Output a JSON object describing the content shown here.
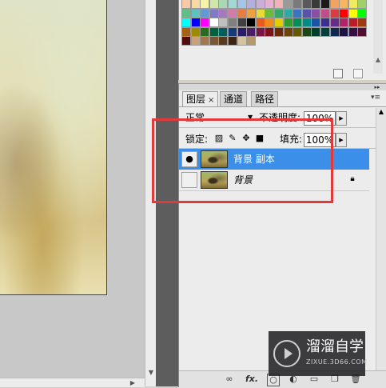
{
  "layers_panel": {
    "tabs": [
      {
        "label": "图层",
        "active": true
      },
      {
        "label": "通道",
        "active": false
      },
      {
        "label": "路径",
        "active": false
      }
    ],
    "tab_close_glyph": "×",
    "blend_mode": "正常",
    "opacity_label": "不透明度:",
    "opacity_value": "100%",
    "lock_label": "锁定:",
    "fill_label": "填充:",
    "fill_value": "100%",
    "layers": [
      {
        "name": "背景 副本",
        "visible": true,
        "selected": true,
        "locked": false
      },
      {
        "name": "背景",
        "visible": false,
        "selected": false,
        "locked": true
      }
    ],
    "bottom_icons": [
      "link-icon",
      "fx-icon",
      "mask-icon",
      "adjustment-icon",
      "group-icon",
      "new-layer-icon",
      "trash-icon"
    ],
    "fx_label": "fx."
  },
  "swatches": {
    "colors": [
      "#f7c9a6",
      "#f8d9a3",
      "#f6f2a6",
      "#cfe7a8",
      "#a9d8b2",
      "#a3d9d5",
      "#a5c4e6",
      "#b3b0dc",
      "#c9afd8",
      "#e6b1cf",
      "#f1b4b6",
      "#9a9a9a",
      "#7a7a7a",
      "#5a5a5a",
      "#3a3a3a",
      "#1a1a1a",
      "#f2a35f",
      "#f6b55f",
      "#f0ea5e",
      "#9fd06a",
      "#5fbf86",
      "#5fc2bf",
      "#6099d6",
      "#7f7ac5",
      "#a678bd",
      "#d47aa9",
      "#e87d3e",
      "#efa23b",
      "#e6dc35",
      "#6dbb3c",
      "#32a86a",
      "#2fa9a4",
      "#3a73c0",
      "#5952ad",
      "#8a4fa4",
      "#c24c8b",
      "#d83c42",
      "#ff0000",
      "#ffff00",
      "#00ff00",
      "#00ffff",
      "#0000ff",
      "#ff00ff",
      "#ffffff",
      "#c0c0c0",
      "#808080",
      "#404040",
      "#000000",
      "#e85a1e",
      "#f08a1a",
      "#e2cf00",
      "#2f9e2f",
      "#008f58",
      "#008c88",
      "#1a53a8",
      "#3a2f92",
      "#6a2a8a",
      "#b0246a",
      "#b81c24",
      "#9e3a12",
      "#a66212",
      "#9c8a00",
      "#2c6a1e",
      "#006040",
      "#005e5c",
      "#163a78",
      "#2a1c66",
      "#4c1c64",
      "#7a1646",
      "#7a1418",
      "#6b2a0c",
      "#6e420c",
      "#645800",
      "#1c4614",
      "#00402a",
      "#003e3c",
      "#0e2852",
      "#1c1246",
      "#340e44",
      "#520e30",
      "#520c10",
      "#c8a27a",
      "#a07850",
      "#7a5634",
      "#5a3a1e",
      "#3c2410",
      "#d4c4a0",
      "#b49a6a"
    ]
  },
  "watermark": {
    "title": "溜溜自学",
    "subtitle": "ZIXUE.3D66.COM"
  }
}
